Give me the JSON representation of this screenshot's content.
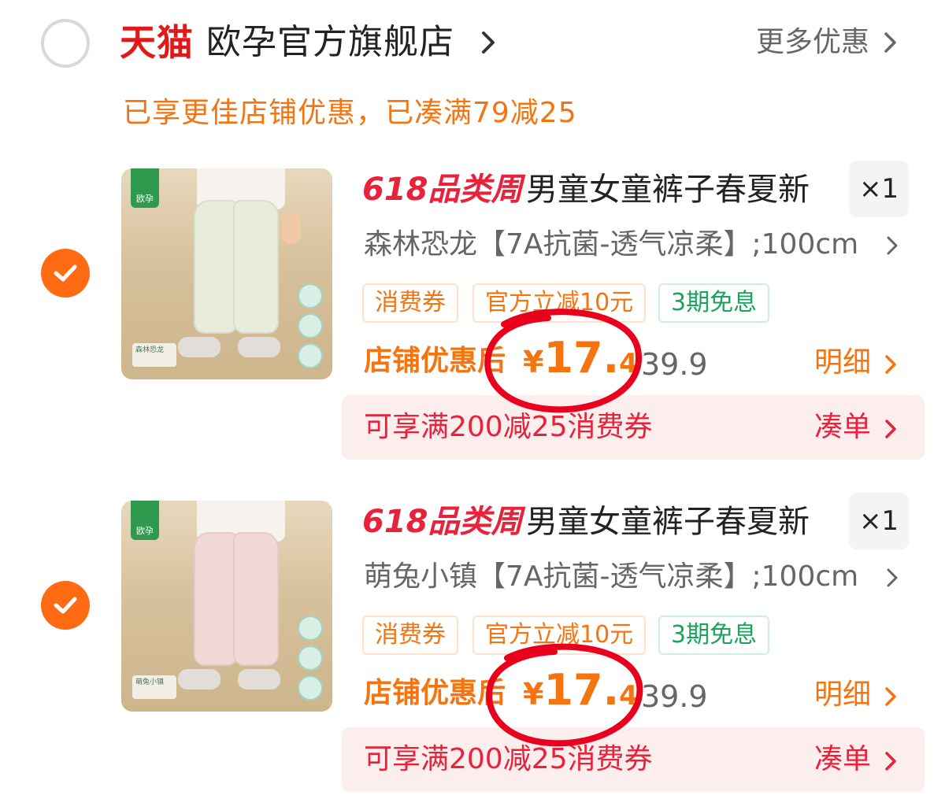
{
  "shop": {
    "platform": "天猫",
    "name": "欧孕官方旗舰店",
    "more_deals": "更多优惠",
    "promo": "已享更佳店铺优惠，已凑满79减25"
  },
  "items": [
    {
      "event_tag": "618品类周",
      "title": "男童女童裤子春夏新",
      "qty": "×1",
      "variant": "森林恐龙【7A抗菌-透气凉柔】;100cm",
      "tags": [
        "消费券",
        "官方立减10元",
        "3期免息"
      ],
      "price_label": "店铺优惠后",
      "price_yen": "¥",
      "price_int": "17.",
      "price_dec": "4",
      "orig_price": "39.9",
      "detail": "明细",
      "coupon_text": "可享满200减25消费券",
      "coupon_link": "凑单",
      "thumb_brand": "欧孕",
      "thumb_caption": "森林恐龙"
    },
    {
      "event_tag": "618品类周",
      "title": "男童女童裤子春夏新",
      "qty": "×1",
      "variant": "萌兔小镇【7A抗菌-透气凉柔】;100cm",
      "tags": [
        "消费券",
        "官方立减10元",
        "3期免息"
      ],
      "price_label": "店铺优惠后",
      "price_yen": "¥",
      "price_int": "17.",
      "price_dec": "4",
      "orig_price": "39.9",
      "detail": "明细",
      "coupon_text": "可享满200减25消费券",
      "coupon_link": "凑单",
      "thumb_brand": "欧孕",
      "thumb_caption": "萌兔小镇"
    }
  ],
  "colors": {
    "accent": "#f5740f",
    "tmall_red": "#e01919",
    "event_red": "#e8223a",
    "check": "#ff6a12",
    "annotation": "#e8001c"
  }
}
